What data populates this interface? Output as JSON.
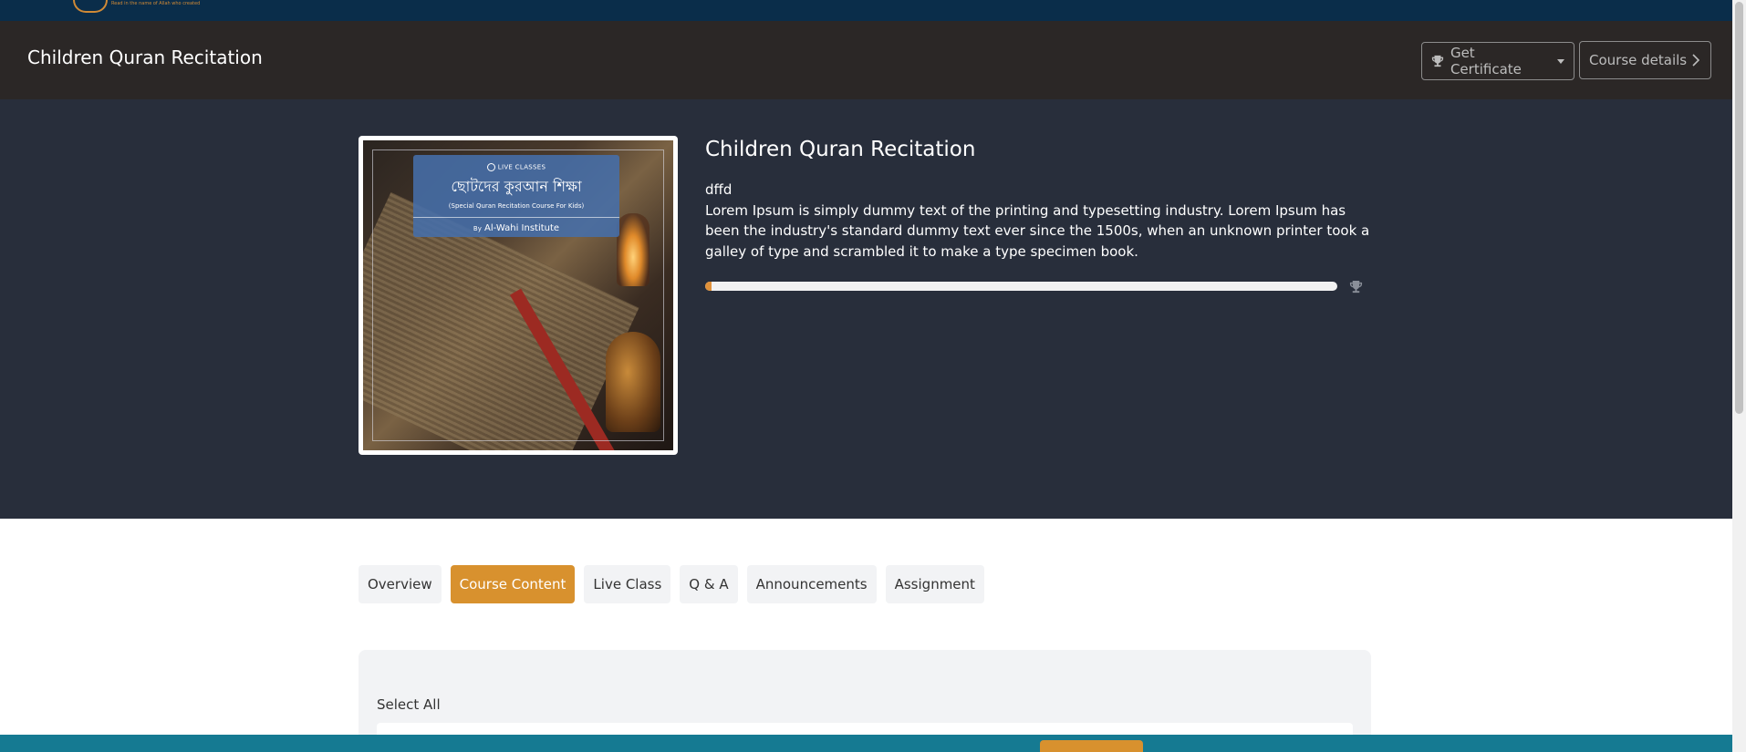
{
  "brand": {
    "logo_tagline": "Read in the name of Allah who created"
  },
  "header": {
    "title": "Children Quran Recitation",
    "get_certificate_label": "Get Certificate",
    "course_details_label": "Course details"
  },
  "course": {
    "title": "Children Quran Recitation",
    "description_line1": "dffd",
    "description_body": "Lorem Ipsum is simply dummy text of the printing and typesetting industry. Lorem Ipsum has been the industry's standard dummy text ever since the 1500s, when an unknown printer took a galley of type and scrambled it to make a type specimen book.",
    "progress_percent": 1,
    "thumbnail": {
      "tag": "LIVE CLASSES",
      "title": "ছোটদের কুরআন শিক্ষা",
      "subtitle": "(Special Quran Recitation Course For Kids)",
      "by_prefix": "By",
      "by": "Al-Wahi Institute"
    }
  },
  "tabs": [
    {
      "label": "Overview",
      "active": false
    },
    {
      "label": "Course Content",
      "active": true
    },
    {
      "label": "Live Class",
      "active": false
    },
    {
      "label": "Q & A",
      "active": false
    },
    {
      "label": "Announcements",
      "active": false
    },
    {
      "label": "Assignment",
      "active": false
    }
  ],
  "content": {
    "select_all_label": "Select All"
  },
  "colors": {
    "accent": "#d8912e",
    "header_bg": "#2b2726",
    "hero_bg": "#282e3b",
    "top_strip": "#0a2d4a",
    "bottom_bar": "#157a92"
  },
  "icons": {
    "certificate": "trophy-icon",
    "details": "chevron-right-icon",
    "progress_end": "trophy-icon"
  }
}
